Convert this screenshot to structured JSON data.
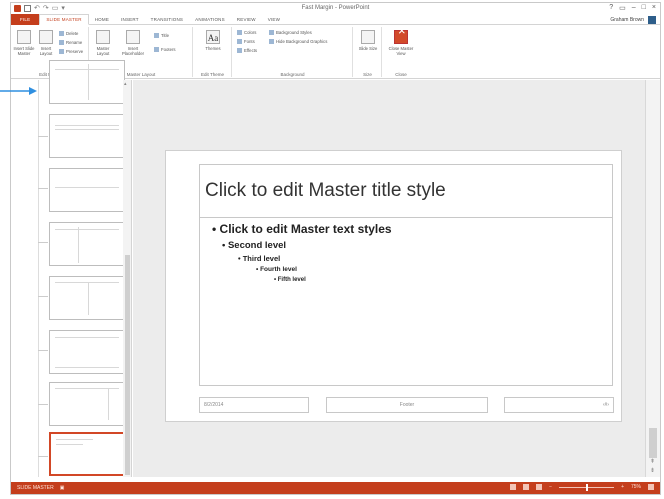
{
  "window": {
    "title": "Fast Margin - PowerPoint",
    "controls": [
      "?",
      "▭",
      "–",
      "□",
      "×"
    ],
    "account_name": "Graham Brown"
  },
  "tabs": [
    {
      "label": "FILE"
    },
    {
      "label": "SLIDE MASTER",
      "active": true
    },
    {
      "label": "HOME"
    },
    {
      "label": "INSERT"
    },
    {
      "label": "TRANSITIONS"
    },
    {
      "label": "ANIMATIONS"
    },
    {
      "label": "REVIEW"
    },
    {
      "label": "VIEW"
    }
  ],
  "ribbon": {
    "edit_master": {
      "label": "Edit Master",
      "insert_slide_master": "Insert Slide Master",
      "insert_layout": "Insert Layout",
      "delete": "Delete",
      "rename": "Rename",
      "preserve": "Preserve"
    },
    "master_layout": {
      "label": "Master Layout",
      "master_layout_btn": "Master Layout",
      "insert_placeholder": "Insert Placeholder",
      "title": "Title",
      "footers": "Footers"
    },
    "edit_theme": {
      "label": "Edit Theme",
      "themes": "Themes"
    },
    "background": {
      "label": "Background",
      "colors": "Colors",
      "fonts": "Fonts",
      "effects": "Effects",
      "background_styles": "Background Styles",
      "hide_background": "Hide Background Graphics"
    },
    "size": {
      "label": "Size",
      "slide_size": "Slide Size"
    },
    "close": {
      "label": "Close",
      "close_master_view": "Close Master View"
    }
  },
  "slide": {
    "title_placeholder": "Click to edit Master title style",
    "levels": [
      "• Click to edit Master text styles",
      "• Second level",
      "• Third level",
      "• Fourth level",
      "• Fifth level"
    ],
    "footer_date": "8/2/2014",
    "footer_center": "Footer",
    "footer_number": "‹#›"
  },
  "status": {
    "left": "SLIDE MASTER",
    "zoom_text": "75%"
  },
  "colors": {
    "accent": "#c43e1c",
    "callout": "#2f8fe0"
  }
}
